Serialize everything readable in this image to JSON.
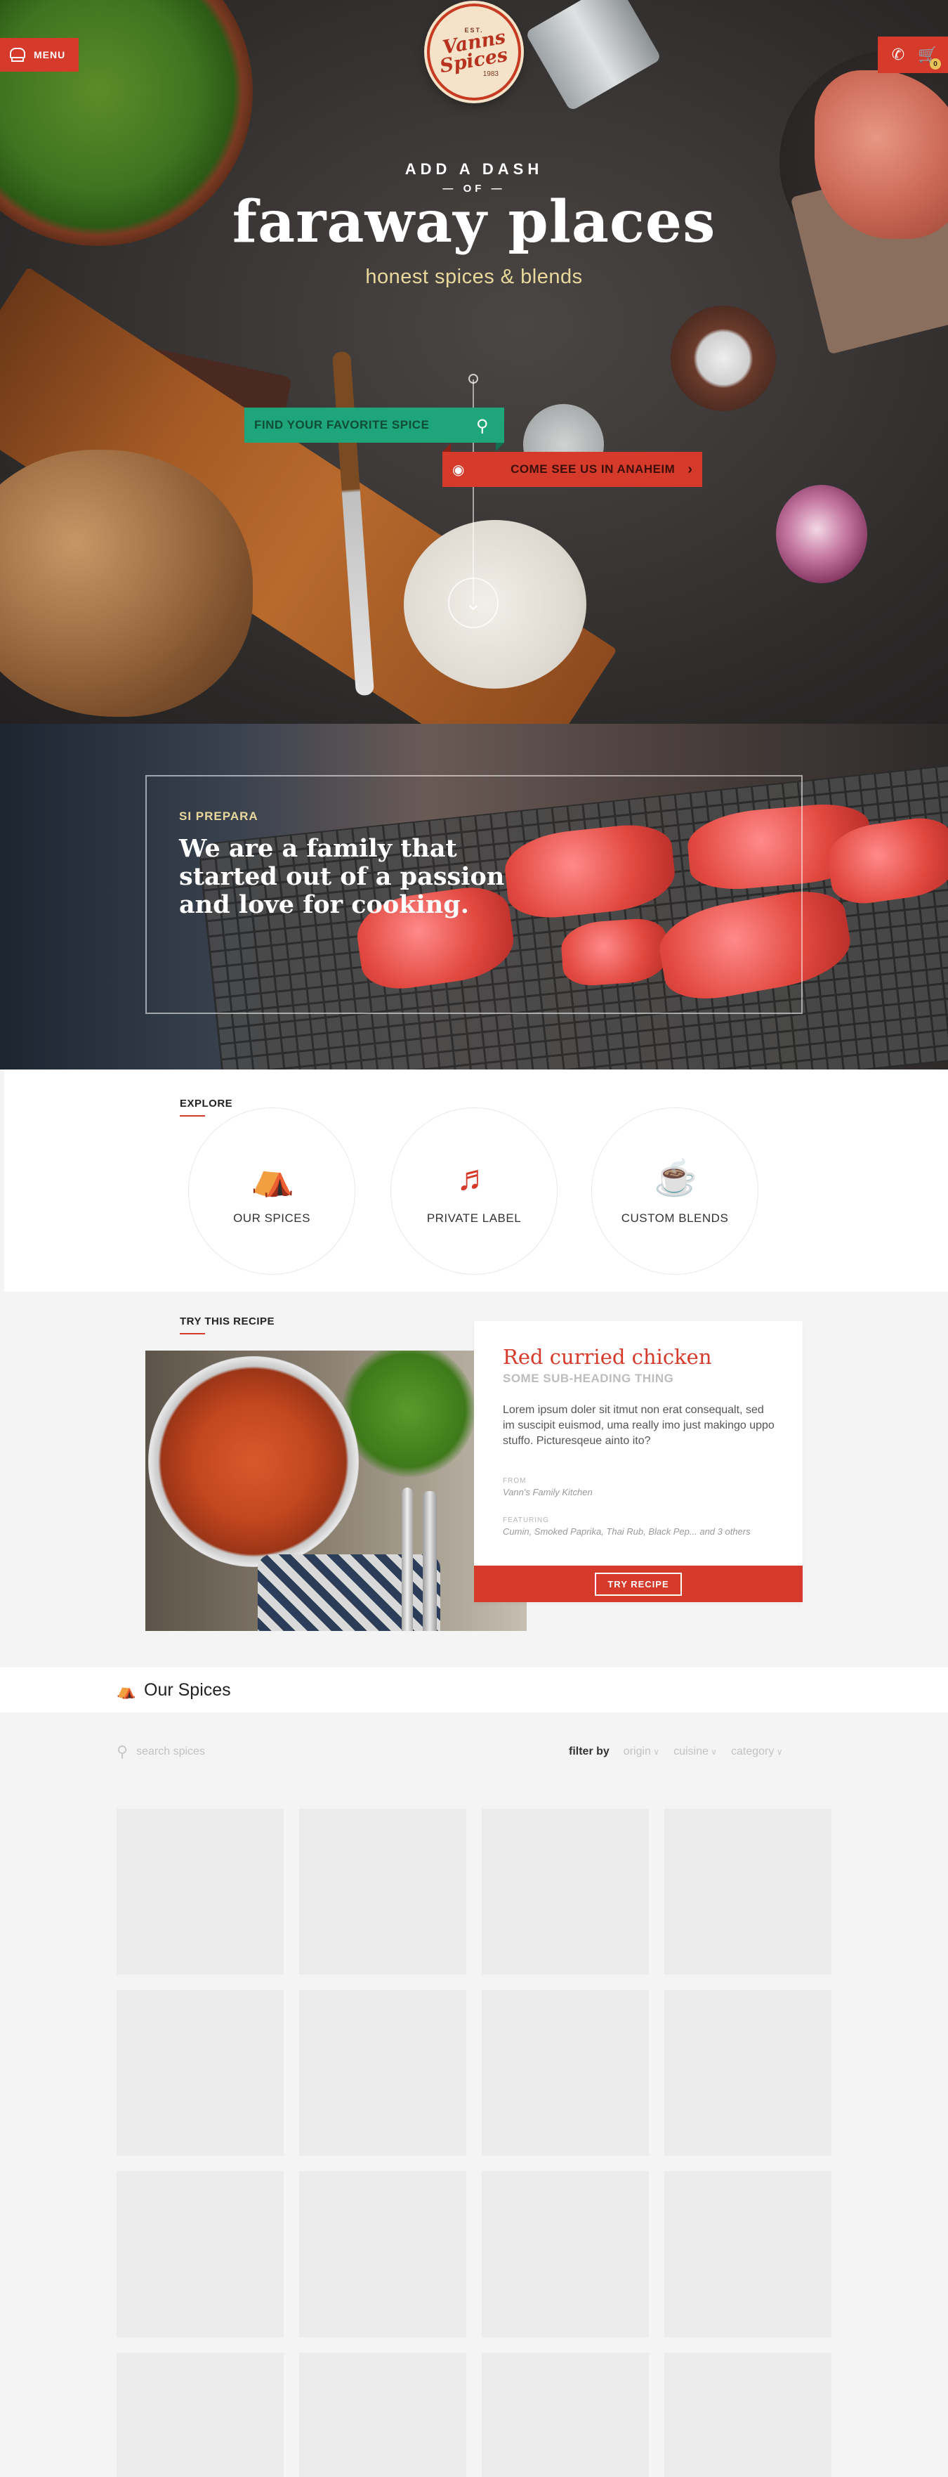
{
  "header": {
    "menu_label": "MENU",
    "cart_count": "0",
    "logo": {
      "est": "EST.",
      "name_line1": "Vanns",
      "name_line2": "Spices",
      "year": "1983"
    }
  },
  "hero": {
    "tag_top": "ADD A DASH",
    "tag_of": "— OF —",
    "headline": "faraway places",
    "subline": "honest spices & blends",
    "search_placeholder": "FIND YOUR FAVORITE SPICE",
    "visit_label": "COME SEE US IN ANAHEIM"
  },
  "story": {
    "kicker": "SI PREPARA",
    "text": "We are a family that started out of a passion and love for cooking."
  },
  "explore": {
    "label": "EXPLORE",
    "items": [
      {
        "label": "OUR SPICES",
        "icon": "spice-grinder-icon"
      },
      {
        "label": "PRIVATE LABEL",
        "icon": "chef-hat-icon"
      },
      {
        "label": "CUSTOM BLENDS",
        "icon": "mortar-pestle-icon"
      }
    ]
  },
  "recipe": {
    "label": "TRY THIS RECIPE",
    "title": "Red curried chicken",
    "subtitle": "SOME SUB-HEADING THING",
    "description": "Lorem ipsum doler sit itmut non erat consequalt, sed im suscipit euismod, uma really imo just makingo uppo stuffo. Picturesqeue ainto ito?",
    "from_label": "FROM",
    "from_value": "Vann's Family Kitchen",
    "featuring_label": "FEATURING",
    "featuring_value": "Cumin, Smoked Paprika, Thai Rub, Black Pep... and 3 others",
    "cta_label": "TRY RECIPE"
  },
  "spices": {
    "title": "Our Spices",
    "search_placeholder": "search spices",
    "filter_label": "filter by",
    "filters": [
      "origin",
      "cuisine",
      "category"
    ],
    "tile_count": 16
  },
  "colors": {
    "accent": "#d63a2b",
    "green": "#1fa57a",
    "cream": "#e9d89c"
  }
}
